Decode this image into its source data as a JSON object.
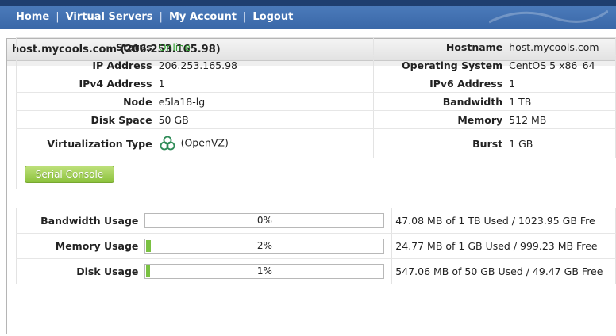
{
  "nav": {
    "items": [
      "Home",
      "Virtual Servers",
      "My Account",
      "Logout"
    ],
    "separator": "|"
  },
  "server": {
    "title": "host.mycools.com (206.253.165.98)"
  },
  "info": {
    "rows": [
      {
        "l1": "Status",
        "v1": "Online",
        "l2": "Hostname",
        "v2": "host.mycools.com"
      },
      {
        "l1": "IP Address",
        "v1": "206.253.165.98",
        "l2": "Operating System",
        "v2": "CentOS 5 x86_64"
      },
      {
        "l1": "IPv4 Address",
        "v1": "1",
        "l2": "IPv6 Address",
        "v2": "1"
      },
      {
        "l1": "Node",
        "v1": "e5la18-lg",
        "l2": "Bandwidth",
        "v2": "1 TB"
      },
      {
        "l1": "Disk Space",
        "v1": "50 GB",
        "l2": "Memory",
        "v2": "512 MB"
      },
      {
        "l1": "Virtualization Type",
        "v1": "(OpenVZ)",
        "l2": "Burst",
        "v2": "1 GB"
      }
    ]
  },
  "console_button": "Serial Console",
  "usage": [
    {
      "label": "Bandwidth Usage",
      "percent_text": "0%",
      "percent": 0,
      "detail": "47.08 MB of 1 TB Used / 1023.95 GB Fre"
    },
    {
      "label": "Memory Usage",
      "percent_text": "2%",
      "percent": 2,
      "detail": "24.77 MB of 1 GB Used / 999.23 MB Free"
    },
    {
      "label": "Disk Usage",
      "percent_text": "1%",
      "percent": 1,
      "detail": "547.06 MB of 50 GB Used / 49.47 GB Free"
    }
  ],
  "colors": {
    "nav_bg": "#4a78b8",
    "online": "#2f9e2f",
    "progress_fill": "#7ac142",
    "console_button": "#9ccb4a"
  }
}
